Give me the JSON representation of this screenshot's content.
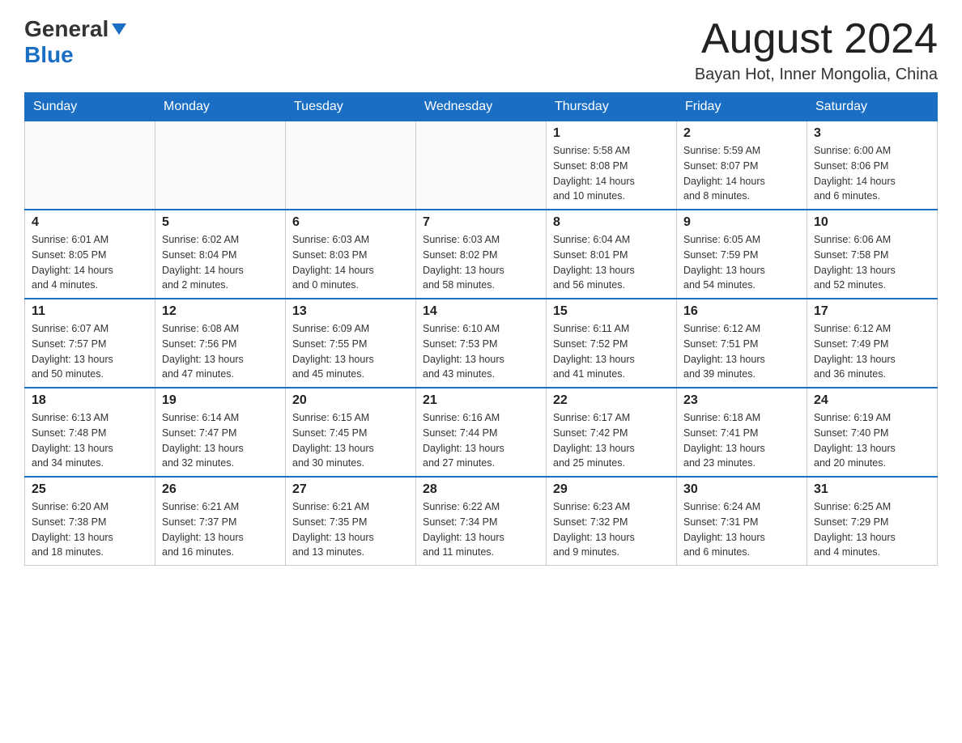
{
  "header": {
    "logo_general": "General",
    "logo_blue": "Blue",
    "month_title": "August 2024",
    "location": "Bayan Hot, Inner Mongolia, China"
  },
  "days_of_week": [
    "Sunday",
    "Monday",
    "Tuesday",
    "Wednesday",
    "Thursday",
    "Friday",
    "Saturday"
  ],
  "weeks": [
    [
      {
        "day": "",
        "info": ""
      },
      {
        "day": "",
        "info": ""
      },
      {
        "day": "",
        "info": ""
      },
      {
        "day": "",
        "info": ""
      },
      {
        "day": "1",
        "info": "Sunrise: 5:58 AM\nSunset: 8:08 PM\nDaylight: 14 hours\nand 10 minutes."
      },
      {
        "day": "2",
        "info": "Sunrise: 5:59 AM\nSunset: 8:07 PM\nDaylight: 14 hours\nand 8 minutes."
      },
      {
        "day": "3",
        "info": "Sunrise: 6:00 AM\nSunset: 8:06 PM\nDaylight: 14 hours\nand 6 minutes."
      }
    ],
    [
      {
        "day": "4",
        "info": "Sunrise: 6:01 AM\nSunset: 8:05 PM\nDaylight: 14 hours\nand 4 minutes."
      },
      {
        "day": "5",
        "info": "Sunrise: 6:02 AM\nSunset: 8:04 PM\nDaylight: 14 hours\nand 2 minutes."
      },
      {
        "day": "6",
        "info": "Sunrise: 6:03 AM\nSunset: 8:03 PM\nDaylight: 14 hours\nand 0 minutes."
      },
      {
        "day": "7",
        "info": "Sunrise: 6:03 AM\nSunset: 8:02 PM\nDaylight: 13 hours\nand 58 minutes."
      },
      {
        "day": "8",
        "info": "Sunrise: 6:04 AM\nSunset: 8:01 PM\nDaylight: 13 hours\nand 56 minutes."
      },
      {
        "day": "9",
        "info": "Sunrise: 6:05 AM\nSunset: 7:59 PM\nDaylight: 13 hours\nand 54 minutes."
      },
      {
        "day": "10",
        "info": "Sunrise: 6:06 AM\nSunset: 7:58 PM\nDaylight: 13 hours\nand 52 minutes."
      }
    ],
    [
      {
        "day": "11",
        "info": "Sunrise: 6:07 AM\nSunset: 7:57 PM\nDaylight: 13 hours\nand 50 minutes."
      },
      {
        "day": "12",
        "info": "Sunrise: 6:08 AM\nSunset: 7:56 PM\nDaylight: 13 hours\nand 47 minutes."
      },
      {
        "day": "13",
        "info": "Sunrise: 6:09 AM\nSunset: 7:55 PM\nDaylight: 13 hours\nand 45 minutes."
      },
      {
        "day": "14",
        "info": "Sunrise: 6:10 AM\nSunset: 7:53 PM\nDaylight: 13 hours\nand 43 minutes."
      },
      {
        "day": "15",
        "info": "Sunrise: 6:11 AM\nSunset: 7:52 PM\nDaylight: 13 hours\nand 41 minutes."
      },
      {
        "day": "16",
        "info": "Sunrise: 6:12 AM\nSunset: 7:51 PM\nDaylight: 13 hours\nand 39 minutes."
      },
      {
        "day": "17",
        "info": "Sunrise: 6:12 AM\nSunset: 7:49 PM\nDaylight: 13 hours\nand 36 minutes."
      }
    ],
    [
      {
        "day": "18",
        "info": "Sunrise: 6:13 AM\nSunset: 7:48 PM\nDaylight: 13 hours\nand 34 minutes."
      },
      {
        "day": "19",
        "info": "Sunrise: 6:14 AM\nSunset: 7:47 PM\nDaylight: 13 hours\nand 32 minutes."
      },
      {
        "day": "20",
        "info": "Sunrise: 6:15 AM\nSunset: 7:45 PM\nDaylight: 13 hours\nand 30 minutes."
      },
      {
        "day": "21",
        "info": "Sunrise: 6:16 AM\nSunset: 7:44 PM\nDaylight: 13 hours\nand 27 minutes."
      },
      {
        "day": "22",
        "info": "Sunrise: 6:17 AM\nSunset: 7:42 PM\nDaylight: 13 hours\nand 25 minutes."
      },
      {
        "day": "23",
        "info": "Sunrise: 6:18 AM\nSunset: 7:41 PM\nDaylight: 13 hours\nand 23 minutes."
      },
      {
        "day": "24",
        "info": "Sunrise: 6:19 AM\nSunset: 7:40 PM\nDaylight: 13 hours\nand 20 minutes."
      }
    ],
    [
      {
        "day": "25",
        "info": "Sunrise: 6:20 AM\nSunset: 7:38 PM\nDaylight: 13 hours\nand 18 minutes."
      },
      {
        "day": "26",
        "info": "Sunrise: 6:21 AM\nSunset: 7:37 PM\nDaylight: 13 hours\nand 16 minutes."
      },
      {
        "day": "27",
        "info": "Sunrise: 6:21 AM\nSunset: 7:35 PM\nDaylight: 13 hours\nand 13 minutes."
      },
      {
        "day": "28",
        "info": "Sunrise: 6:22 AM\nSunset: 7:34 PM\nDaylight: 13 hours\nand 11 minutes."
      },
      {
        "day": "29",
        "info": "Sunrise: 6:23 AM\nSunset: 7:32 PM\nDaylight: 13 hours\nand 9 minutes."
      },
      {
        "day": "30",
        "info": "Sunrise: 6:24 AM\nSunset: 7:31 PM\nDaylight: 13 hours\nand 6 minutes."
      },
      {
        "day": "31",
        "info": "Sunrise: 6:25 AM\nSunset: 7:29 PM\nDaylight: 13 hours\nand 4 minutes."
      }
    ]
  ]
}
